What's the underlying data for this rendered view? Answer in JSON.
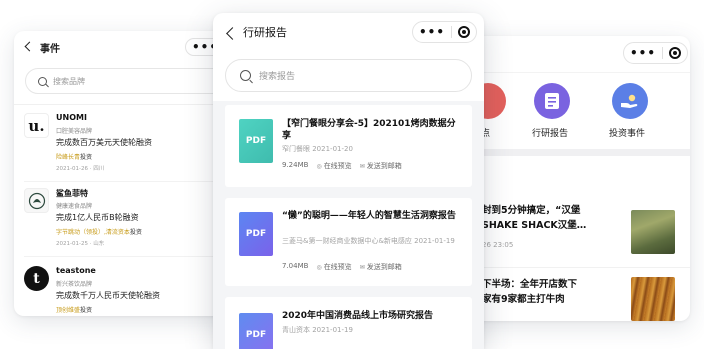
{
  "left_screen": {
    "title": "事件",
    "search_placeholder": "搜索品牌",
    "events": [
      {
        "name": "UNOMI",
        "logo_text": "u.",
        "category": "口腔美容品牌",
        "desc": "完成数百万美元天使轮融资",
        "investor": "险峰长青",
        "inv_suffix": "投资",
        "date": "2021-01-26 · 四川"
      },
      {
        "name": "鲨鱼菲特",
        "category": "健康速食品牌",
        "desc": "完成1亿人民币B轮融资",
        "investor": "字节跳动（领投）,清流资本",
        "inv_suffix": "投资",
        "date": "2021-01-25 · 山东"
      },
      {
        "name": "teastone",
        "category": "新兴茶饮品牌",
        "desc": "完成数千万人民币天使轮融资",
        "investor": "顶创维盛",
        "inv_suffix": "投资",
        "date": ""
      }
    ]
  },
  "middle_screen": {
    "title": "行研报告",
    "search_placeholder": "搜索报告",
    "reports": [
      {
        "badge": "PDF",
        "title": "【窄门餐眼分享会-5】202101烤肉数据分享",
        "meta": "窄门餐眼  2021-01-20",
        "size": "9.24MB",
        "preview": "在线预览",
        "email": "发送到邮箱"
      },
      {
        "badge": "PDF",
        "title": "“懒”的聪明——年轻人的智慧生活洞察报告",
        "meta": "三菱马&第一财经商业数据中心&新电感应  2021-01-19",
        "size": "7.04MB",
        "preview": "在线预览",
        "email": "发送到邮箱"
      },
      {
        "badge": "PDF",
        "title": "2020年中国消费品线上市场研究报告",
        "meta": "青山资本  2021-01-19",
        "size": "",
        "preview": "",
        "email": ""
      }
    ]
  },
  "right_screen": {
    "categories": [
      {
        "label": "点",
        "icon": "location-icon",
        "color": "#e3605c"
      },
      {
        "label": "行研报告",
        "icon": "report-icon",
        "color": "#7a63e0"
      },
      {
        "label": "投资事件",
        "icon": "invest-hand-icon",
        "color": "#5b7fe6"
      }
    ],
    "news": [
      {
        "line1": "封到5分钟搞定，“汉堡",
        "line2": "SHAKE SHACK汉堡…",
        "time": "26 23:05"
      },
      {
        "line1": "下半场：全年开店数下",
        "line2": "家有9家都主打牛肉",
        "time": ""
      }
    ]
  },
  "colors": {
    "pdf_teal": "#3fc5b7",
    "pdf_blue": "#5f7df0",
    "pdf_purple": "#8a6ff0",
    "gold": "#c79a16"
  }
}
